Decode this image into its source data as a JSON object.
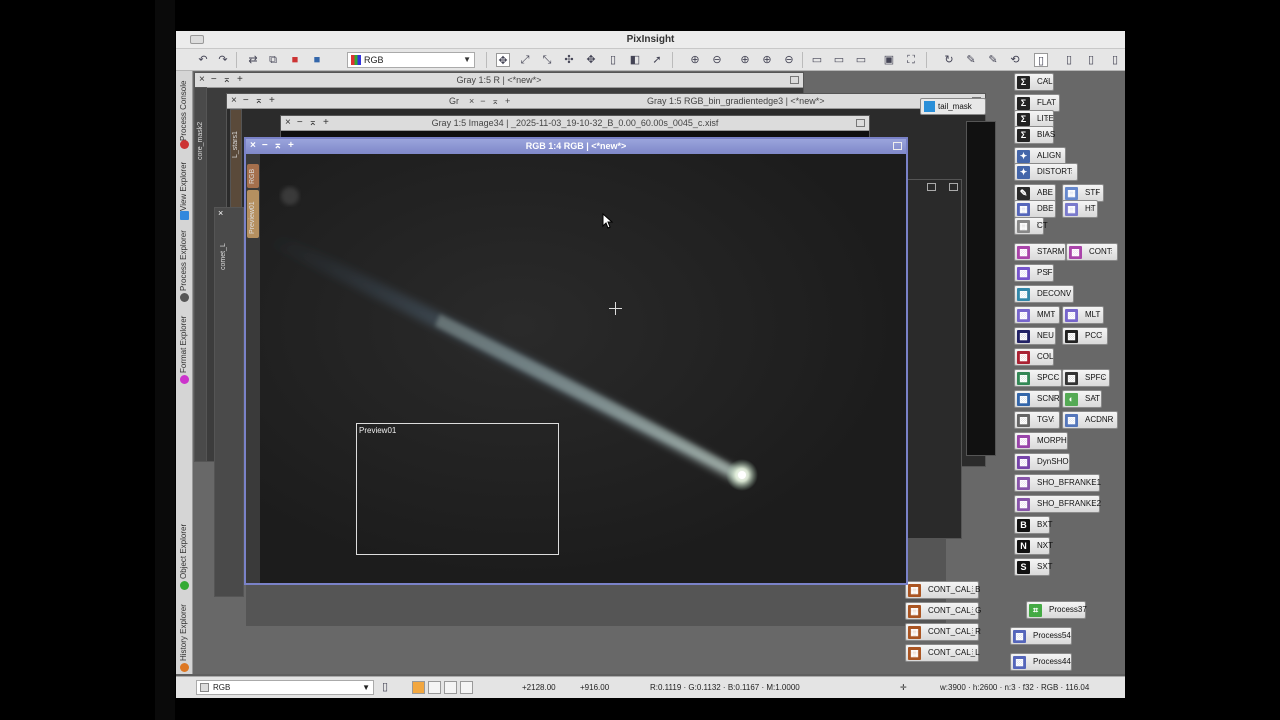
{
  "app": {
    "title": "PixInsight"
  },
  "toolbar": {
    "view_selector": "RGB"
  },
  "side_tabs": [
    {
      "label": "Process Console",
      "dot_color": "#cc3333"
    },
    {
      "label": "View Explorer",
      "dot_color": "#3388dd"
    },
    {
      "label": "Process Explorer",
      "dot_color": "#555555"
    },
    {
      "label": "Format Explorer",
      "dot_color": "#cc33cc"
    },
    {
      "label": "Object Explorer",
      "dot_color": "#33aa33"
    },
    {
      "label": "History Explorer",
      "dot_color": "#dd7722"
    }
  ],
  "windows": {
    "w1_title": "Gray 1:5 R | <*new*>",
    "w2_title": "Gray 1:5 RGB_bin_gradientedge3 | <*new*>",
    "w3_title": "Gray 1:5 Image34 | _2025-11-03_19-10-32_B_0.00_60.00s_0045_c.xisf",
    "w2_prefix": "Gr",
    "left_labels": [
      "core_mask2",
      "L_stars1",
      "comet_L"
    ],
    "tail_mask_label": "tail_mask"
  },
  "active_window": {
    "title": "RGB 1:4 RGB | <*new*>",
    "tabs": [
      "RGB",
      "Preview01"
    ],
    "preview_label": "Preview01"
  },
  "process_icons": [
    {
      "label": "CAL",
      "icon": "sigma-icon",
      "glyph": "Σ",
      "color": "#222222"
    },
    {
      "label": "FLAT",
      "icon": "sigma-icon",
      "glyph": "Σ",
      "color": "#222222"
    },
    {
      "label": "LITE",
      "icon": "sigma-icon",
      "glyph": "Σ",
      "color": "#222222"
    },
    {
      "label": "BIAS",
      "icon": "sigma-icon",
      "glyph": "Σ",
      "color": "#222222"
    },
    {
      "label": "ALIGN",
      "icon": "align-icon",
      "glyph": "✦",
      "color": "#4466aa"
    },
    {
      "label": "DISTORT",
      "icon": "distort-icon",
      "glyph": "✦",
      "color": "#4466aa"
    },
    {
      "label": "ABE",
      "icon": "abe-icon",
      "glyph": "✎",
      "color": "#2a2a2a"
    },
    {
      "label": "STF",
      "icon": "stf-icon",
      "glyph": "▦",
      "color": "#6688cc"
    },
    {
      "label": "DBE",
      "icon": "dbe-icon",
      "glyph": "▦",
      "color": "#5566bb"
    },
    {
      "label": "HT",
      "icon": "ht-icon",
      "glyph": "▦",
      "color": "#7a7acc"
    },
    {
      "label": "CT",
      "icon": "ct-icon",
      "glyph": "▦",
      "color": "#888888"
    },
    {
      "label": "STARM",
      "icon": "starm-icon",
      "glyph": "▩",
      "color": "#aa44aa"
    },
    {
      "label": "CONT",
      "icon": "cont-icon",
      "glyph": "▩",
      "color": "#aa44aa"
    },
    {
      "label": "PSF",
      "icon": "psf-icon",
      "glyph": "▩",
      "color": "#7755cc"
    },
    {
      "label": "DECONV",
      "icon": "deconv-icon",
      "glyph": "▩",
      "color": "#3388aa"
    },
    {
      "label": "MMT",
      "icon": "mmt-icon",
      "glyph": "▩",
      "color": "#7766cc"
    },
    {
      "label": "MLT",
      "icon": "mlt-icon",
      "glyph": "▩",
      "color": "#7766cc"
    },
    {
      "label": "NEU",
      "icon": "neu-icon",
      "glyph": "▩",
      "color": "#222266"
    },
    {
      "label": "PCC",
      "icon": "pcc-icon",
      "glyph": "▩",
      "color": "#222222"
    },
    {
      "label": "COL",
      "icon": "col-icon",
      "glyph": "▩",
      "color": "#aa2233"
    },
    {
      "label": "SPCC",
      "icon": "spcc-icon",
      "glyph": "▩",
      "color": "#338855"
    },
    {
      "label": "SPFC",
      "icon": "spfc-icon",
      "glyph": "▩",
      "color": "#333333"
    },
    {
      "label": "SCNR",
      "icon": "scnr-icon",
      "glyph": "▩",
      "color": "#3366aa"
    },
    {
      "label": "SAT",
      "icon": "sat-icon",
      "glyph": "◐",
      "color": "#55aa55"
    },
    {
      "label": "TGV",
      "icon": "tgv-icon",
      "glyph": "▩",
      "color": "#666666"
    },
    {
      "label": "ACDNR",
      "icon": "acdnr-icon",
      "glyph": "▩",
      "color": "#5577bb"
    },
    {
      "label": "MORPH",
      "icon": "morph-icon",
      "glyph": "▩",
      "color": "#9944aa"
    },
    {
      "label": "DynSHO",
      "icon": "dynsho-icon",
      "glyph": "▩",
      "color": "#7744aa"
    },
    {
      "label": "SHO_BFRANKE1",
      "icon": "sho-icon",
      "glyph": "▩",
      "color": "#8855aa"
    },
    {
      "label": "SHO_BFRANKE2",
      "icon": "sho-icon",
      "glyph": "▩",
      "color": "#8855aa"
    },
    {
      "label": "BXT",
      "icon": "b-icon",
      "glyph": "B",
      "color": "#111111"
    },
    {
      "label": "NXT",
      "icon": "n-icon",
      "glyph": "N",
      "color": "#111111"
    },
    {
      "label": "SXT",
      "icon": "s-icon",
      "glyph": "S",
      "color": "#111111"
    },
    {
      "label": "CONT_CAL_B",
      "icon": "pixelmath-icon",
      "glyph": "▦",
      "color": "#aa5522"
    },
    {
      "label": "CONT_CAL_G",
      "icon": "pixelmath-icon",
      "glyph": "▦",
      "color": "#aa5522"
    },
    {
      "label": "CONT_CAL_R",
      "icon": "pixelmath-icon",
      "glyph": "▦",
      "color": "#aa5522"
    },
    {
      "label": "CONT_CAL_L",
      "icon": "pixelmath-icon",
      "glyph": "▦",
      "color": "#aa5522"
    },
    {
      "label": "Process37",
      "icon": "crop-icon",
      "glyph": "⌗",
      "color": "#44aa44"
    },
    {
      "label": "Process54",
      "icon": "process-icon",
      "glyph": "▩",
      "color": "#5566bb"
    },
    {
      "label": "Process44",
      "icon": "process-icon",
      "glyph": "▩",
      "color": "#5566bb"
    }
  ],
  "statusbar": {
    "view": "RGB",
    "coords_x": "+2128.00",
    "coords_y": "+916.00",
    "pixel_values": "R:0.1119 · G:0.1132 · B:0.1167 · M:1.0000",
    "image_info": "w:3900 · h:2600 · n:3 · f32 · RGB · 116.04"
  }
}
